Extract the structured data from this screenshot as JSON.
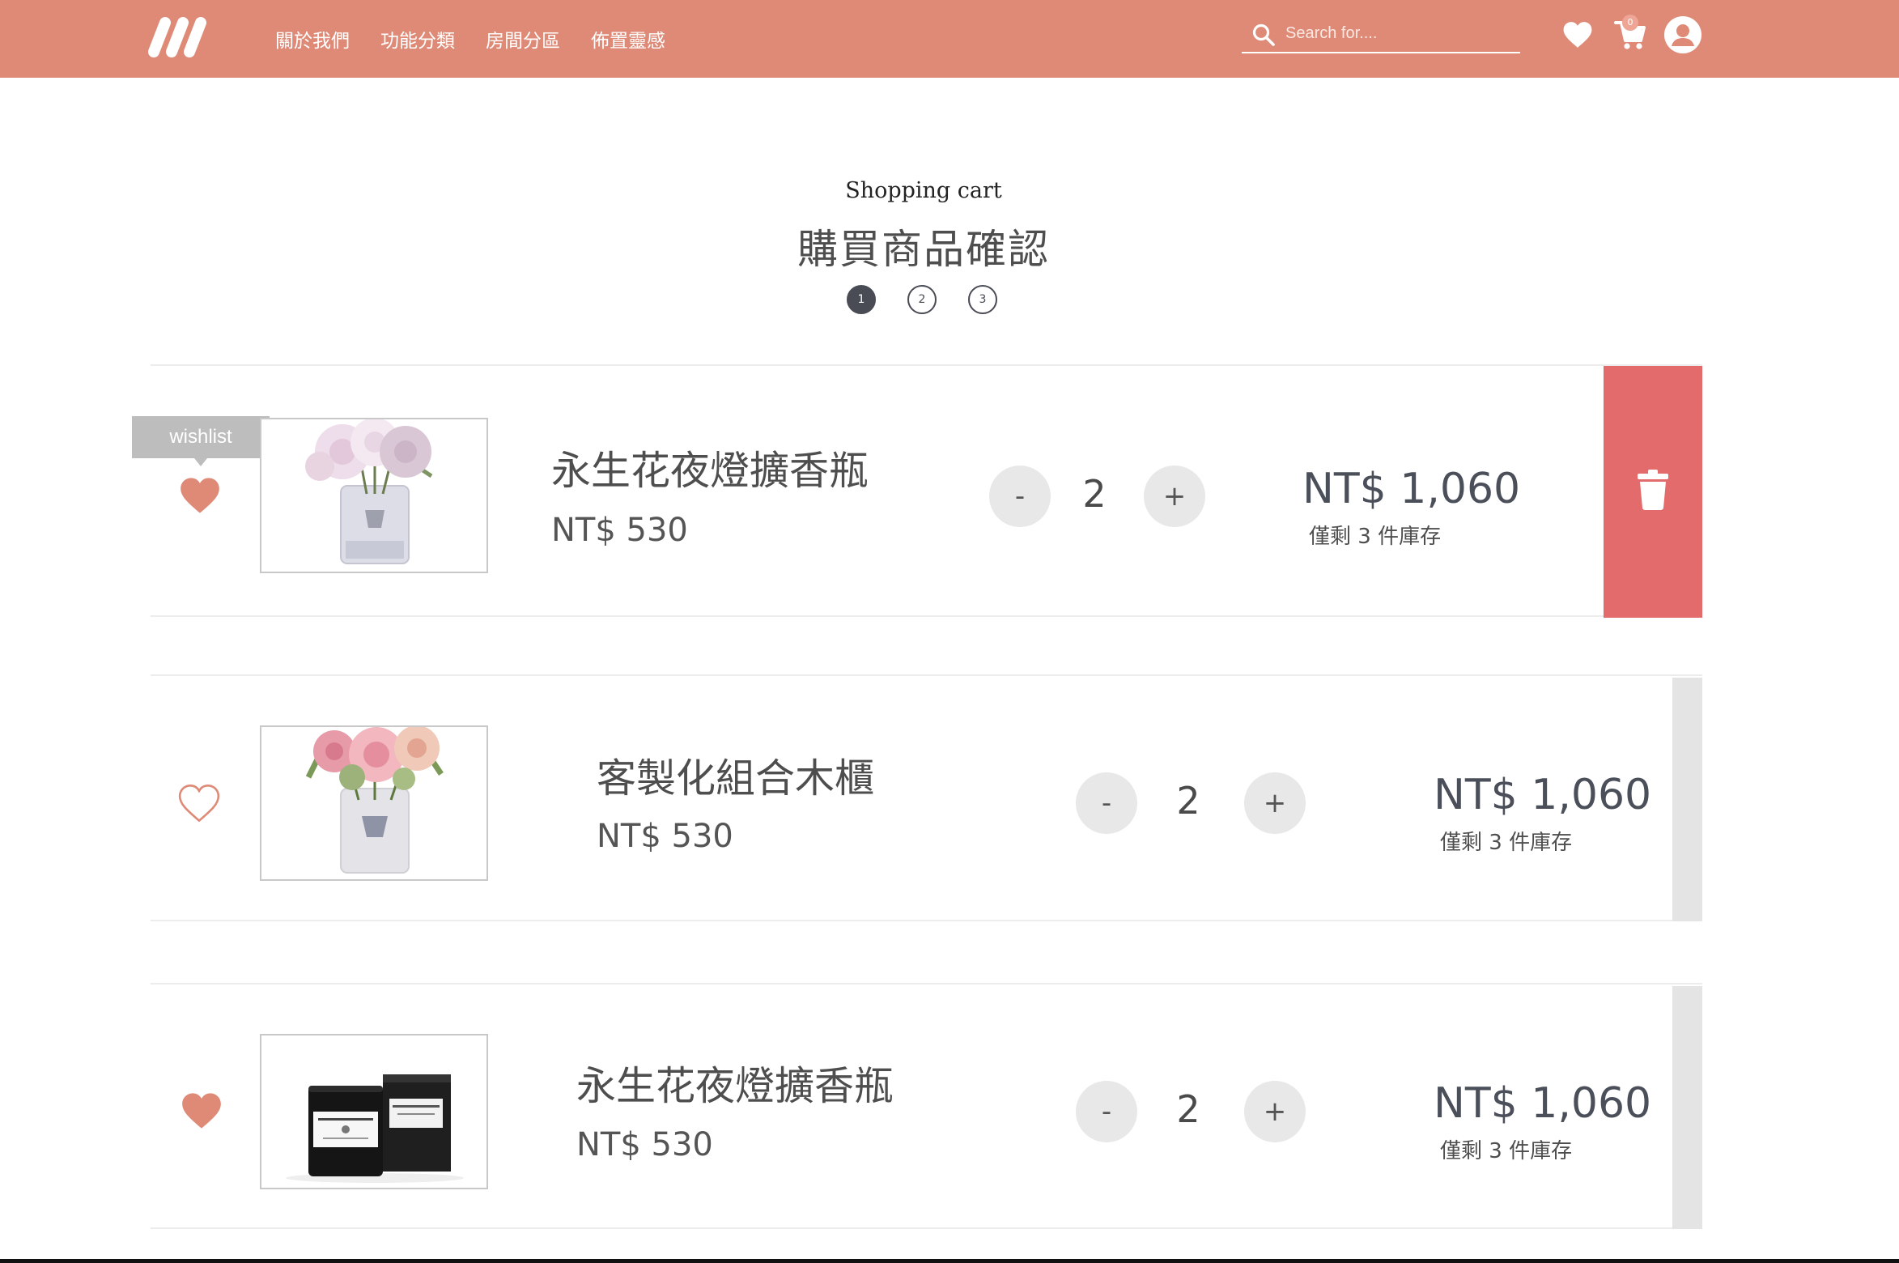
{
  "header": {
    "brand_color": "#de8a77",
    "logo_icon": "brand-logo-three-strokes-icon",
    "nav": [
      "關於我們",
      "功能分類",
      "房間分區",
      "佈置靈感"
    ],
    "search_placeholder": "Search for....",
    "cart_count": "0"
  },
  "page": {
    "subtitle": "Shopping cart",
    "title": "購買商品確認",
    "steps": [
      "1",
      "2",
      "3"
    ],
    "active_step": "1"
  },
  "cart": {
    "tooltip": "wishlist",
    "accent_color": "#e46b6b",
    "items": [
      {
        "name": "永生花夜燈擴香瓶",
        "unit_price": "NT$ 530",
        "qty": "2",
        "minus": "-",
        "plus": "+",
        "total": "NT$ 1,060",
        "stock": "僅剩 3 件庫存",
        "wishlisted": true,
        "image": "pink-peony-diffuser-image"
      },
      {
        "name": "客製化組合木櫃",
        "unit_price": "NT$ 530",
        "qty": "2",
        "minus": "-",
        "plus": "+",
        "total": "NT$ 1,060",
        "stock": "僅剩 3 件庫存",
        "wishlisted": false,
        "image": "rose-bouquet-diffuser-image"
      },
      {
        "name": "永生花夜燈擴香瓶",
        "unit_price": "NT$ 530",
        "qty": "2",
        "minus": "-",
        "plus": "+",
        "total": "NT$ 1,060",
        "stock": "僅剩 3 件庫存",
        "wishlisted": true,
        "image": "scented-candle-box-image"
      }
    ]
  }
}
